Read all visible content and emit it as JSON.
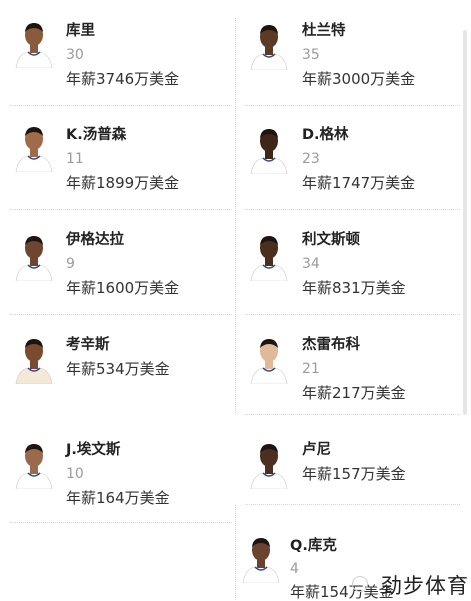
{
  "players": [
    {
      "name": "库里",
      "number": "30",
      "salary": "年薪3746万美金",
      "jersey": "#ffffff"
    },
    {
      "name": "杜兰特",
      "number": "35",
      "salary": "年薪3000万美金",
      "jersey": "#ffffff"
    },
    {
      "name": "K.汤普森",
      "number": "11",
      "salary": "年薪1899万美金",
      "jersey": "#ffffff"
    },
    {
      "name": "D.格林",
      "number": "23",
      "salary": "年薪1747万美金",
      "jersey": "#ffffff"
    },
    {
      "name": "伊格达拉",
      "number": "9",
      "salary": "年薪1600万美金",
      "jersey": "#ffffff"
    },
    {
      "name": "利文斯顿",
      "number": "34",
      "salary": "年薪831万美金",
      "jersey": "#ffffff"
    },
    {
      "name": "考辛斯",
      "number": "",
      "salary": "年薪534万美金",
      "jersey": "#f3e9d6"
    },
    {
      "name": "杰雷布科",
      "number": "21",
      "salary": "年薪217万美金",
      "jersey": "#ffffff"
    },
    {
      "name": "J.埃文斯",
      "number": "10",
      "salary": "年薪164万美金",
      "jersey": "#ffffff"
    },
    {
      "name": "卢尼",
      "number": "",
      "salary": "年薪157万美金",
      "jersey": "#ffffff"
    },
    {
      "name": "Q.库克",
      "number": "4",
      "salary": "年薪154万美金",
      "jersey": "#ffffff"
    }
  ],
  "watermark": "劲步体育",
  "colors": {
    "text": "#222222",
    "number": "#9b9b9b",
    "separator": "#d8d8d8"
  }
}
